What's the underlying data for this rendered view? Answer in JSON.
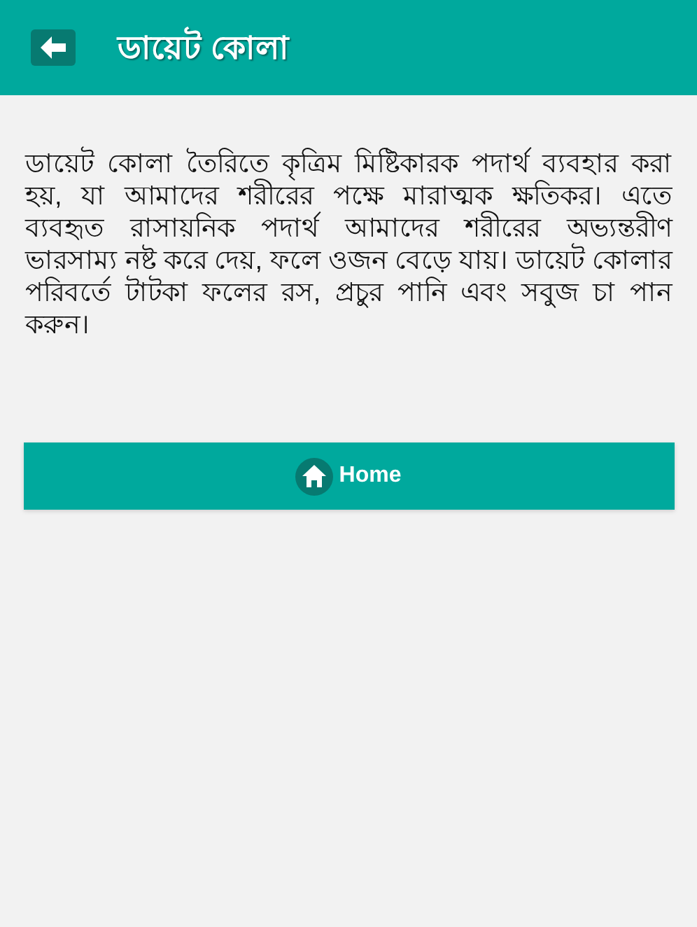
{
  "header": {
    "title": "ডায়েট কোলা"
  },
  "body": {
    "text": "ডায়েট কোলা তৈরিতে কৃত্রিম মিষ্টিকারক পদার্থ ব্যবহার করা হয়, যা আমাদের শরীরের পক্ষে মারাত্মক ক্ষতিকর। এতে ব্যবহৃত রাসায়নিক পদার্থ আমাদের শরীরের অভ্যন্তরীণ ভারসাম্য নষ্ট করে দেয়, ফলে ওজন বেড়ে যায়। ডায়েট কোলার পরিবর্তে টাটকা ফলের রস, প্রচুর পানি এবং সবুজ চা পান করুন।"
  },
  "home_button": {
    "label": "Home"
  }
}
